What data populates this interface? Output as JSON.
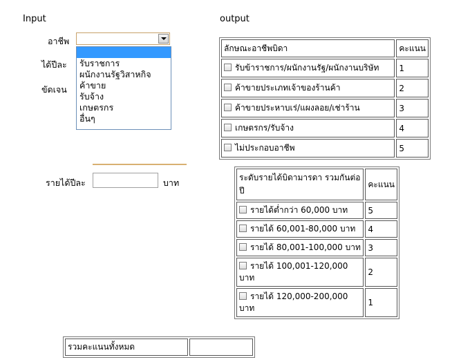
{
  "input_heading": "Input",
  "output_heading": "output",
  "form": {
    "occupation_label": "อาชีพ",
    "occupation_value": "",
    "occupation_options": [
      "",
      "รับราชการ",
      "ผนักงานรัฐวิสาหกิจ",
      "ค้าขาย",
      "รับจ้าง",
      "เกษตรกร",
      "อื่นๆ"
    ],
    "partial_label_1": "ได้ปีละ",
    "partial_label_2": "ขัดเจน",
    "income_label": "รายได้ปีละ",
    "income_value": "",
    "income_unit": "บาท"
  },
  "occupation_table": {
    "header_col1": "ลักษณะอาชีพบิดา",
    "header_col2": "คะแนน",
    "rows": [
      {
        "label": "รับข้าราชการ/ผนักงานรัฐ/ผนักงานบริษัท",
        "score": "1"
      },
      {
        "label": "ค้าขายประเภทเจ้าของร้านค้า",
        "score": "2"
      },
      {
        "label": "ค้าขายประหาบเร่/แผงลอย/เช่าร้าน",
        "score": "3"
      },
      {
        "label": "เกษตรกร/รับจ้าง",
        "score": "4"
      },
      {
        "label": "ไม่ประกอบอาชีพ",
        "score": "5"
      }
    ]
  },
  "income_table": {
    "header_col1": "ระดับรายได้บิดามารดา รวมกันต่อปี",
    "header_col2": "คะแนน",
    "rows": [
      {
        "label": "รายได้ต่ำกว่า 60,000 บาท",
        "score": "5"
      },
      {
        "label": "รายได้ 60,001-80,000 บาท",
        "score": "4"
      },
      {
        "label": "รายได้ 80,001-100,000 บาท",
        "score": "3"
      },
      {
        "label_line1": "รายได้ 100,001-120,000",
        "label_line2": "บาท",
        "score": "2"
      },
      {
        "label_line1": "รายได้ 120,000-200,000",
        "label_line2": "บาท",
        "score": "1"
      }
    ]
  },
  "total": {
    "label": "รวมคะแนนทั้งหมด",
    "value": ""
  }
}
